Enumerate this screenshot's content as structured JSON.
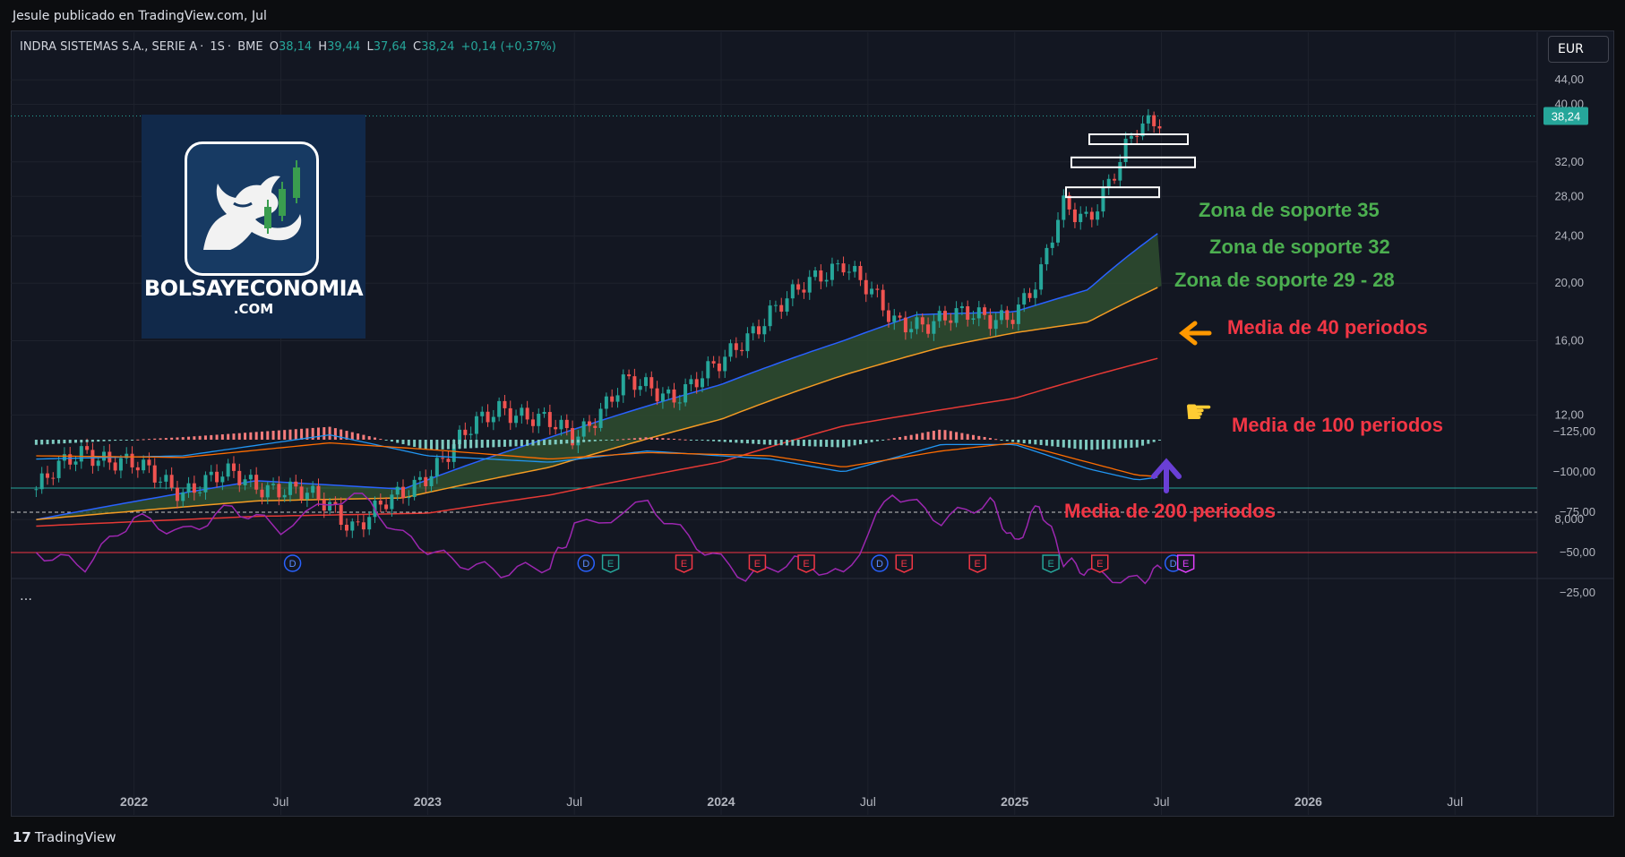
{
  "header": {
    "author": "Jesule publicado en TradingView.com, Jul"
  },
  "symbol": {
    "name": "INDRA SISTEMAS S.A., SERIE A",
    "interval": "1S",
    "exchange": "BME",
    "o_label": "O",
    "o": "38,14",
    "h_label": "H",
    "h": "39,44",
    "l_label": "L",
    "l": "37,64",
    "c_label": "C",
    "c": "38,24",
    "change": "+0,14 (+0,37%)"
  },
  "currency": "EUR",
  "last_price_label": "38,24",
  "logo": {
    "title": "BOLSAYECONOMIA",
    "subtitle": ".COM"
  },
  "footer": {
    "brand": "TradingView",
    "mark": "17"
  },
  "indicator_menu": "…",
  "colors": {
    "up": "#26a69a",
    "down": "#ef5350",
    "ma40": "#2962ff",
    "ma100": "#f59b23",
    "ma200": "#e53935",
    "fill": "#2f4d2f",
    "rsi": "#9c27b0",
    "macd": "#2196f3",
    "signal": "#ff6d00",
    "annotation_green": "#4caf50",
    "annotation_red": "#f23645"
  },
  "chart_data": [
    {
      "type": "candlestick",
      "interval": "weekly",
      "ylim": [
        6.5,
        48
      ],
      "y_ticks": [
        "44,00",
        "40,00",
        "32,00",
        "28,00",
        "24,00",
        "20,00",
        "16,00",
        "12,00",
        "8,000"
      ],
      "x_ticks": [
        "2022",
        "Jul",
        "2023",
        "Jul",
        "2024",
        "Jul",
        "2025",
        "Jul",
        "2026",
        "Jul"
      ],
      "price_path": [
        [
          "2021-09",
          9.0
        ],
        [
          "2021-11",
          10.5
        ],
        [
          "2022-01",
          9.8
        ],
        [
          "2022-03",
          9.0
        ],
        [
          "2022-05",
          9.5
        ],
        [
          "2022-07",
          9.0
        ],
        [
          "2022-09",
          8.5
        ],
        [
          "2022-10",
          7.8
        ],
        [
          "2022-12",
          8.8
        ],
        [
          "2023-02",
          10.5
        ],
        [
          "2023-04",
          12.5
        ],
        [
          "2023-06",
          11.5
        ],
        [
          "2023-07",
          11.0
        ],
        [
          "2023-09",
          13.5
        ],
        [
          "2023-11",
          13.0
        ],
        [
          "2024-01",
          14.5
        ],
        [
          "2024-03",
          18.0
        ],
        [
          "2024-04",
          19.0
        ],
        [
          "2024-06",
          22.0
        ],
        [
          "2024-07",
          19.5
        ],
        [
          "2024-08",
          17.0
        ],
        [
          "2024-10",
          17.5
        ],
        [
          "2024-12",
          17.5
        ],
        [
          "2025-01",
          18.0
        ],
        [
          "2025-02",
          20.0
        ],
        [
          "2025-03",
          27.0
        ],
        [
          "2025-04",
          26.0
        ],
        [
          "2025-05",
          30.0
        ],
        [
          "2025-06",
          36.0
        ],
        [
          "2025-07",
          38.24
        ]
      ],
      "moving_averages": [
        {
          "name": "MA40",
          "points": [
            [
              "2021-09",
              8.0
            ],
            [
              "2022-06",
              9.3
            ],
            [
              "2022-12",
              9.0
            ],
            [
              "2023-06",
              11.0
            ],
            [
              "2024-01",
              13.5
            ],
            [
              "2024-06",
              16.0
            ],
            [
              "2024-09",
              17.7
            ],
            [
              "2025-01",
              17.9
            ],
            [
              "2025-04",
              19.5
            ],
            [
              "2025-07",
              24.5
            ]
          ]
        },
        {
          "name": "MA100",
          "points": [
            [
              "2021-09",
              8.0
            ],
            [
              "2022-06",
              8.6
            ],
            [
              "2022-12",
              8.7
            ],
            [
              "2023-06",
              9.8
            ],
            [
              "2024-01",
              11.8
            ],
            [
              "2024-06",
              14.0
            ],
            [
              "2024-10",
              15.6
            ],
            [
              "2025-01",
              16.5
            ],
            [
              "2025-04",
              17.2
            ],
            [
              "2025-07",
              19.8
            ]
          ]
        },
        {
          "name": "MA200",
          "points": [
            [
              "2021-09",
              7.8
            ],
            [
              "2022-06",
              8.1
            ],
            [
              "2023-01",
              8.2
            ],
            [
              "2023-06",
              8.8
            ],
            [
              "2024-01",
              10.0
            ],
            [
              "2024-06",
              11.5
            ],
            [
              "2025-01",
              12.8
            ],
            [
              "2025-07",
              15.0
            ]
          ]
        }
      ],
      "events": [
        {
          "date": "2022-07",
          "label": "D"
        },
        {
          "date": "2023-07",
          "label": "D"
        },
        {
          "date": "2023-08",
          "label": "E"
        },
        {
          "date": "2023-11",
          "label": "E"
        },
        {
          "date": "2024-02",
          "label": "E"
        },
        {
          "date": "2024-04",
          "label": "E"
        },
        {
          "date": "2024-07",
          "label": "D"
        },
        {
          "date": "2024-08",
          "label": "E"
        },
        {
          "date": "2024-11",
          "label": "E"
        },
        {
          "date": "2025-02",
          "label": "E"
        },
        {
          "date": "2025-04",
          "label": "E"
        },
        {
          "date": "2025-07",
          "label": "D"
        },
        {
          "date": "2025-07",
          "label": "E"
        }
      ],
      "annotations": [
        {
          "text": "Zona de soporte 35",
          "level": 35
        },
        {
          "text": "Zona de soporte 32",
          "level": 32
        },
        {
          "text": "Zona de soporte 29 - 28",
          "level": 28.5
        },
        {
          "text": "Media de 40 periodos"
        },
        {
          "text": "Media de 100 periodos"
        },
        {
          "text": "Media de 200 periodos"
        }
      ]
    },
    {
      "type": "line",
      "name": "oscillator",
      "y_ticks": [
        "−25,00",
        "−50,00",
        "−75,00",
        "−100,00",
        "−125,00"
      ],
      "bands": [
        -50,
        -75,
        -90
      ],
      "points": [
        [
          "2021-09",
          -50
        ],
        [
          "2021-11",
          -42
        ],
        [
          "2022-01",
          -72
        ],
        [
          "2022-03",
          -62
        ],
        [
          "2022-05",
          -78
        ],
        [
          "2022-07",
          -65
        ],
        [
          "2022-10",
          -88
        ],
        [
          "2022-12",
          -60
        ],
        [
          "2023-02",
          -45
        ],
        [
          "2023-04",
          -38
        ],
        [
          "2023-06",
          -42
        ],
        [
          "2023-07",
          -65
        ],
        [
          "2023-10",
          -80
        ],
        [
          "2023-12",
          -55
        ],
        [
          "2024-02",
          -35
        ],
        [
          "2024-04",
          -45
        ],
        [
          "2024-06",
          -35
        ],
        [
          "2024-08",
          -88
        ],
        [
          "2024-10",
          -70
        ],
        [
          "2024-12",
          -82
        ],
        [
          "2025-01",
          -55
        ],
        [
          "2025-02",
          -80
        ],
        [
          "2025-03",
          -45
        ],
        [
          "2025-04",
          -38
        ],
        [
          "2025-06",
          -32
        ],
        [
          "2025-07",
          -40
        ]
      ]
    },
    {
      "type": "bar",
      "name": "macd",
      "series": [
        {
          "points": [
            [
              "2021-09",
              -108
            ],
            [
              "2022-03",
              -110
            ],
            [
              "2022-09",
              -123
            ],
            [
              "2023-01",
              -110
            ],
            [
              "2023-06",
              -106
            ],
            [
              "2023-10",
              -113
            ],
            [
              "2024-03",
              -108
            ],
            [
              "2024-06",
              -100
            ],
            [
              "2024-10",
              -117
            ],
            [
              "2025-01",
              -117
            ],
            [
              "2025-04",
              -102
            ],
            [
              "2025-06",
              -95
            ],
            [
              "2025-07",
              -97
            ]
          ]
        },
        {
          "points": [
            [
              "2021-09",
              -110
            ],
            [
              "2022-03",
              -109
            ],
            [
              "2022-09",
              -118
            ],
            [
              "2023-01",
              -114
            ],
            [
              "2023-06",
              -108
            ],
            [
              "2023-10",
              -112
            ],
            [
              "2024-03",
              -110
            ],
            [
              "2024-06",
              -103
            ],
            [
              "2024-10",
              -113
            ],
            [
              "2025-01",
              -118
            ],
            [
              "2025-04",
              -106
            ],
            [
              "2025-06",
              -98
            ],
            [
              "2025-07",
              -97
            ]
          ]
        }
      ]
    }
  ]
}
